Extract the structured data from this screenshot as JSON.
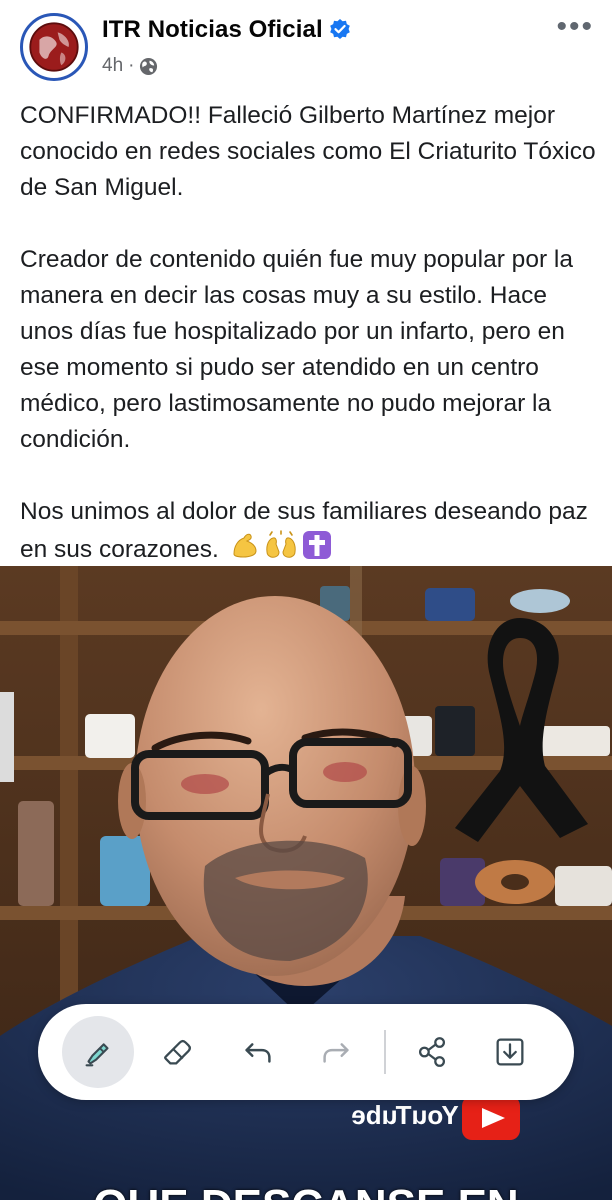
{
  "post": {
    "page_name": "ITR Noticias Oficial",
    "time": "4h",
    "separator": "·",
    "more_label": "•••",
    "paragraphs": [
      "CONFIRMADO!! Falleció Gilberto Martínez mejor conocido en redes sociales como El Criaturito Tóxico de San Miguel.",
      "Creador de contenido quién fue muy popular por la manera en decir las cosas muy a su estilo. Hace unos días fue hospitalizado por un infarto, pero en ese momento si pudo ser atendido en un centro médico, pero lastimosamente no pudo mejorar la condición.",
      "Nos unimos al dolor de sus familiares deseando paz en sus corazones."
    ],
    "emojis": [
      "flexed-biceps-emoji",
      "raising-hands-emoji",
      "latin-cross-emoji"
    ]
  },
  "photo": {
    "shirt_logo": "YouTube",
    "caption_partial": "QUE DESCANSE EN"
  },
  "toolbar": {
    "tools": [
      {
        "name": "highlighter-icon",
        "active": true
      },
      {
        "name": "eraser-icon",
        "active": false
      },
      {
        "name": "undo-icon",
        "active": false
      },
      {
        "name": "redo-icon",
        "active": false
      },
      {
        "name": "share-icon",
        "active": false
      },
      {
        "name": "download-icon",
        "active": false
      }
    ]
  },
  "colors": {
    "verified_blue": "#1877f2",
    "avatar_ring": "#2a57b7",
    "text": "#1c1e21",
    "meta": "#65676b"
  }
}
